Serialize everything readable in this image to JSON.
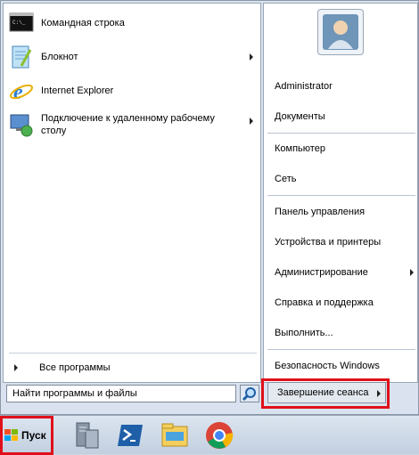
{
  "left_programs": [
    {
      "label": "Командная строка",
      "icon": "cmd-icon"
    },
    {
      "label": "Блокнот",
      "icon": "notepad-icon",
      "submenu": true
    },
    {
      "label": "Internet Explorer",
      "icon": "internet-explorer-icon"
    },
    {
      "label": "Подключение к удаленному рабочему столу",
      "icon": "remote-desktop-icon",
      "submenu": true
    }
  ],
  "all_programs": "Все программы",
  "search": {
    "placeholder": "Найти программы и файлы"
  },
  "right_items": [
    {
      "label": "Administrator"
    },
    {
      "label": "Документы"
    },
    {
      "label": "Компьютер"
    },
    {
      "label": "Сеть"
    },
    {
      "label": "Панель управления"
    },
    {
      "label": "Устройства и принтеры"
    },
    {
      "label": "Администрирование",
      "submenu": true
    },
    {
      "label": "Справка и поддержка"
    },
    {
      "label": "Выполнить..."
    },
    {
      "label": "Безопасность Windows"
    }
  ],
  "shutdown": {
    "label": "Завершение сеанса"
  },
  "start_button": {
    "label": "Пуск"
  },
  "taskbar_icons": [
    "server-manager-icon",
    "powershell-icon",
    "file-explorer-icon",
    "chrome-icon"
  ],
  "colors": {
    "highlight": "#e0101a",
    "menu_bg": "#d9e2ee"
  }
}
